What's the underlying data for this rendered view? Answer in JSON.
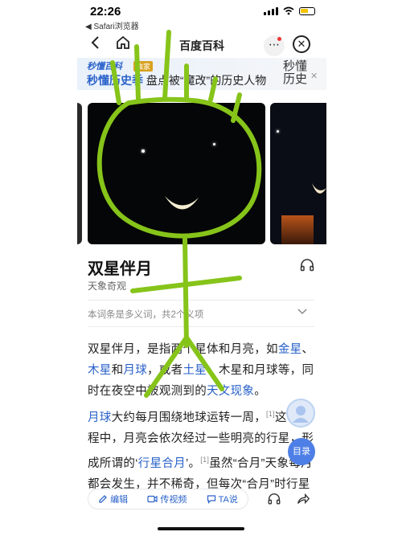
{
  "status": {
    "time": "22:26",
    "back_app": "◀ Safari浏览器"
  },
  "navbar": {
    "title": "百度百科"
  },
  "banner": {
    "brand": "秒懂百科",
    "brand_tag": "独家",
    "headline_blue": "秒懂历史季",
    "headline_rest": " 盘点被“魔改”的历史人物",
    "logo_line1": "秒懂",
    "logo_line2": "历史"
  },
  "entry": {
    "title": "双星伴月",
    "subtitle": "天象奇观",
    "polysemy_note": "本词条是多义词，共2个义项"
  },
  "paragraph1": {
    "t1": "双星伴月，是指两个星体和月亮，如",
    "link1": "金星",
    "t2": "、",
    "link2": "木星",
    "t3": "和",
    "link3": "月球",
    "t4": "，或者",
    "link4": "土星",
    "t5": "、木星和月球等，同时在夜空中被观测到的",
    "link5": "天文现象",
    "t6": "。"
  },
  "paragraph2": {
    "link1": "月球",
    "t1": "大约每月围绕地球运转一周，",
    "ref1": "[1]",
    "t2": "这个过程中，月亮会依次经过一些明亮的行星，形成所谓的‘",
    "link2": "行星合月",
    "t3": "’。",
    "ref2": "[1]",
    "t4": "虽然“合月”天象每月都会发生，并不稀奇，但每次“合月”时行星"
  },
  "floating": {
    "toc_label": "目录"
  },
  "bottombar": {
    "edit_label": "编辑",
    "video_label": "传视频",
    "ta_label": "TA说"
  },
  "colors": {
    "link": "#2a62c9",
    "scribble": "#86c41a",
    "toc": "#4e7fe6"
  }
}
